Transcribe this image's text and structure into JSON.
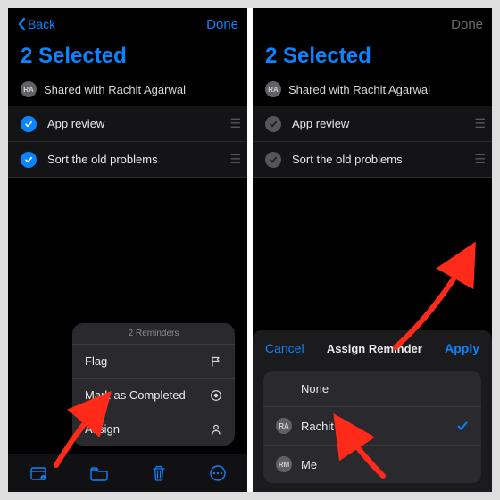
{
  "nav": {
    "back": "Back",
    "done": "Done"
  },
  "header": {
    "title": "2 Selected"
  },
  "shared": {
    "avatar_initials": "RA",
    "text": "Shared with Rachit Agarwal"
  },
  "reminders": [
    {
      "label": "App review"
    },
    {
      "label": "Sort the old problems"
    }
  ],
  "menu": {
    "header": "2 Reminders",
    "items": [
      {
        "label": "Flag"
      },
      {
        "label": "Mark as Completed"
      },
      {
        "label": "Assign"
      }
    ]
  },
  "sheet": {
    "cancel": "Cancel",
    "title": "Assign Reminder",
    "apply": "Apply",
    "options": [
      {
        "label": "None",
        "initials": ""
      },
      {
        "label": "Rachit",
        "initials": "RA",
        "selected": true
      },
      {
        "label": "Me",
        "initials": "RM"
      }
    ]
  }
}
